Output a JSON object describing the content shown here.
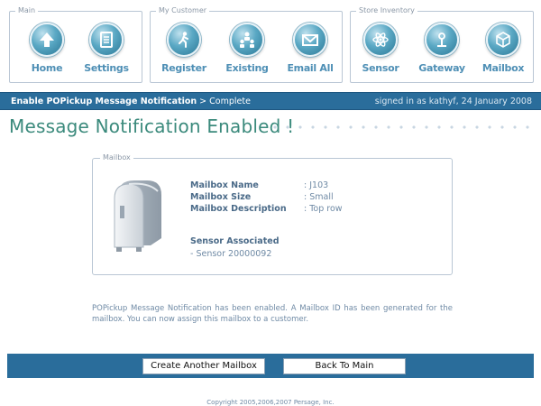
{
  "nav": {
    "groups": [
      {
        "label": "Main",
        "items": [
          {
            "label": "Home",
            "icon": "home-arrow-icon"
          },
          {
            "label": "Settings",
            "icon": "settings-document-icon"
          }
        ]
      },
      {
        "label": "My Customer",
        "items": [
          {
            "label": "Register",
            "icon": "register-walker-icon"
          },
          {
            "label": "Existing",
            "icon": "existing-users-icon"
          },
          {
            "label": "Email All",
            "icon": "email-envelope-icon"
          }
        ]
      },
      {
        "label": "Store Inventory",
        "items": [
          {
            "label": "Sensor",
            "icon": "sensor-atom-icon"
          },
          {
            "label": "Gateway",
            "icon": "gateway-antenna-icon"
          },
          {
            "label": "Mailbox",
            "icon": "mailbox-box-icon"
          }
        ]
      }
    ]
  },
  "topbar": {
    "breadcrumb_current": "Enable POPickup Message Notification",
    "breadcrumb_sep": ">",
    "breadcrumb_step": "Complete",
    "signed_in": "signed in as kathyf, 24 January 2008"
  },
  "page": {
    "title": "Message Notification Enabled !"
  },
  "mailbox": {
    "panel_label": "Mailbox",
    "fields": [
      {
        "name": "Mailbox Name",
        "value": ": J103"
      },
      {
        "name": "Mailbox Size",
        "value": ": Small"
      },
      {
        "name": "Mailbox Description",
        "value": ": Top row"
      }
    ],
    "sensor_title": "Sensor Associated",
    "sensor_value": "- Sensor 20000092"
  },
  "message": "POPickup Message Notification has been enabled. A Mailbox ID has been generated for the mailbox. You can now assign this mailbox to a customer.",
  "buttons": {
    "create_another": "Create Another Mailbox",
    "back_to_main": "Back To Main"
  },
  "footer": {
    "copyright": "Copyright 2005,2006,2007 Persage, Inc."
  },
  "colors": {
    "accent_bar": "#2a6d9b",
    "title_teal": "#3b8a7c",
    "nav_label": "#4e8fb5"
  }
}
